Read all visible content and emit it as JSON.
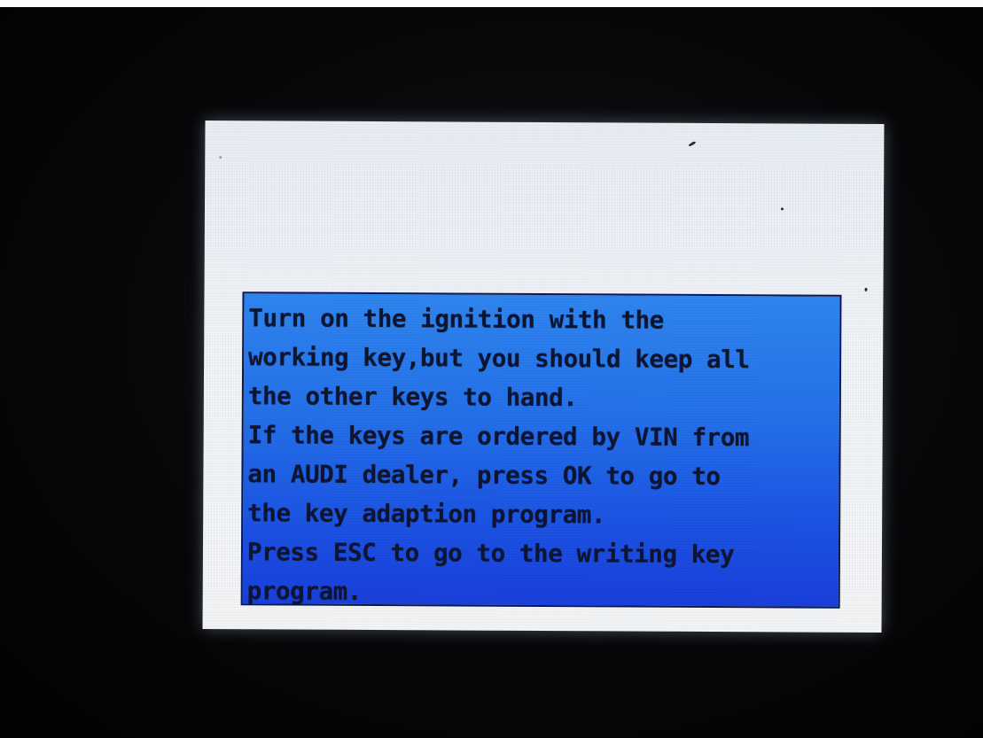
{
  "message": {
    "lines": [
      "Turn on the ignition with the",
      "working key,but you should keep all",
      "the other keys to hand.",
      "If the keys are ordered by VIN from",
      "an AUDI dealer, press OK to go to",
      "the key adaption program.",
      "Press ESC to go to the writing key",
      "program."
    ]
  },
  "colors": {
    "dialog_background": "#2470ea",
    "dialog_text": "#0d1530",
    "screen_background": "#f2f5f9",
    "bezel": "#070709"
  }
}
